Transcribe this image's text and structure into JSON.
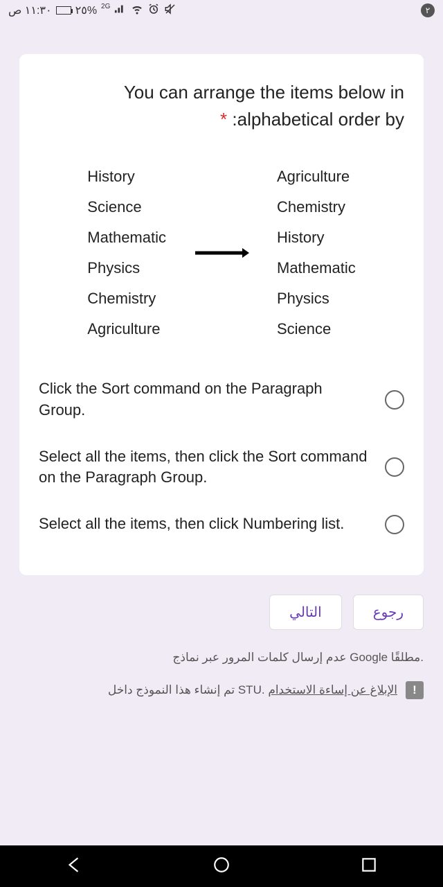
{
  "status": {
    "time": "١١:٣٠ ص",
    "battery": "٢٥%",
    "network": "2G",
    "badge": "٢"
  },
  "question": {
    "title_line1": "You can arrange the items below in",
    "title_line2": ":alphabetical order by"
  },
  "example": {
    "left": [
      "History",
      "Science",
      "Mathematic",
      "Physics",
      "Chemistry",
      "Agriculture"
    ],
    "right": [
      "Agriculture",
      "Chemistry",
      "History",
      "Mathematic",
      "Physics",
      "Science"
    ]
  },
  "options": [
    "Click the Sort command on the Paragraph Group.",
    "Select all the items, then click the Sort command on the Paragraph Group.",
    "Select all the items, then click Numbering list."
  ],
  "nav": {
    "next": "التالي",
    "back": "رجوع"
  },
  "footer": {
    "password_note": "عدم إرسال كلمات المرور عبر نماذج Google مطلقًا.",
    "report_prefix": "تم إنشاء هذا النموذج داخل STU.",
    "report_link": "الإبلاغ عن إساءة الاستخدام"
  }
}
